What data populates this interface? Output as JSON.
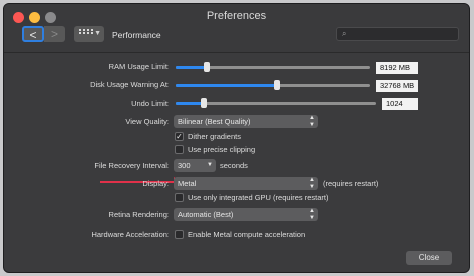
{
  "window": {
    "title": "Preferences"
  },
  "toolbar": {
    "back_glyph": "<",
    "forward_glyph": ">",
    "section": "Performance",
    "search_placeholder": ""
  },
  "ram": {
    "label": "RAM Usage Limit:",
    "value": "8192 MB",
    "fraction": 0.16
  },
  "disk": {
    "label": "Disk Usage Warning At:",
    "value": "32768 MB",
    "fraction": 0.52
  },
  "undo": {
    "label": "Undo Limit:",
    "value": "1024",
    "fraction": 0.14
  },
  "view_quality": {
    "label": "View Quality:",
    "value": "Bilinear (Best Quality)"
  },
  "dither": {
    "label": "Dither gradients",
    "checked": true
  },
  "precise_clipping": {
    "label": "Use precise clipping",
    "checked": false
  },
  "recovery": {
    "label": "File Recovery Interval:",
    "value": "300",
    "unit": "seconds"
  },
  "display": {
    "label": "Display:",
    "value": "Metal",
    "note": "(requires restart)"
  },
  "integrated_gpu": {
    "label": "Use only integrated GPU (requires restart)",
    "checked": false
  },
  "retina": {
    "label": "Retina Rendering:",
    "value": "Automatic (Best)"
  },
  "hw_accel": {
    "label": "Hardware Acceleration:",
    "checkbox_label": "Enable Metal compute acceleration",
    "checked": false
  },
  "footer": {
    "close_label": "Close"
  },
  "colors": {
    "accent": "#2e88f0",
    "annotation_arrow": "#e0314a"
  }
}
